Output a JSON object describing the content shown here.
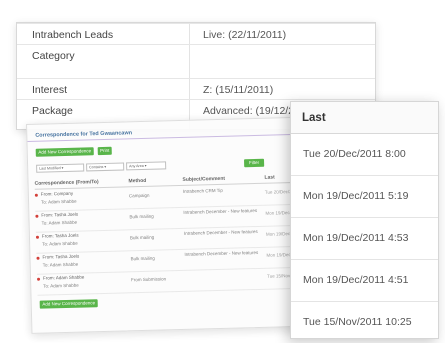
{
  "info": {
    "rows": [
      {
        "label": "Intrabench Leads",
        "value": "Live: (22/11/2011)"
      },
      {
        "label": "Category",
        "value": ""
      },
      {
        "label": "Interest",
        "value": "Z: (15/11/2011)"
      },
      {
        "label": "Package",
        "value": "Advanced: (19/12/2011"
      }
    ]
  },
  "correspondence": {
    "title": "Correspondence for Ted Gwaancawn",
    "add_button_top": "Add New Correspondence",
    "print_button": "Print",
    "filters": [
      "Last Modified ▾",
      "Contains ▾",
      "Any Area ▾"
    ],
    "filter_button": "Filter",
    "columns": [
      "Correspondence (From/To)",
      "Method",
      "Subject/Comment",
      "Last"
    ],
    "rows": [
      {
        "from": "From: Company",
        "to": "To: Adam Shabbe",
        "method": "Campaign",
        "subject": "Intrabench CRM Tip",
        "last": "Tue 20/Dec/2011"
      },
      {
        "from": "From: Tasha Joels",
        "to": "To: Adam Shabbe",
        "method": "Bulk mailing",
        "subject": "Intrabench December - New features",
        "last": "Mon 19/Dec/2011"
      },
      {
        "from": "From: Tasha Joels",
        "to": "To: Adam Shabbe",
        "method": "Bulk mailing",
        "subject": "Intrabench December - New features",
        "last": "Mon 19/Dec/2011"
      },
      {
        "from": "From: Tasha Joels",
        "to": "To: Adam Shabbe",
        "method": "Bulk mailing",
        "subject": "Intrabench December - New features",
        "last": "Mon 19/Dec/2011"
      },
      {
        "from": "From: Adam Shabbe",
        "to": "To: Adam Shabbe",
        "method": "From Submission",
        "subject": "",
        "last": "Tue 15/Nov/2011"
      }
    ],
    "add_button_bottom": "Add New Correspondence"
  },
  "last_panel": {
    "header": "Last",
    "items": [
      "Tue 20/Dec/2011 8:00",
      "Mon 19/Dec/2011 5:19",
      "Mon 19/Dec/2011 4:53",
      "Mon 19/Dec/2011 4:51",
      "Tue 15/Nov/2011 10:25"
    ]
  },
  "colors": {
    "accent_green": "#4caf3b",
    "title_blue": "#3a6a9a",
    "indicator_red": "#d0302a"
  }
}
